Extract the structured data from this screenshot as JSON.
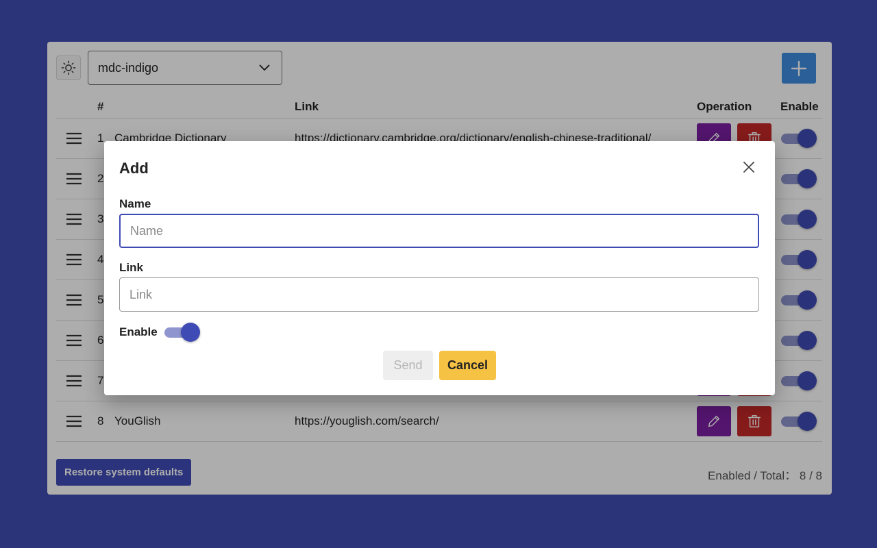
{
  "header": {
    "theme_icon": "sun-icon",
    "selected_theme": "mdc-indigo",
    "add_icon": "plus-icon"
  },
  "table": {
    "columns": {
      "num": "#",
      "link": "Link",
      "operation": "Operation",
      "enable": "Enable"
    },
    "rows": [
      {
        "num": "1",
        "name": "Cambridge Dictionary",
        "link": "https://dictionary.cambridge.org/dictionary/english-chinese-traditional/",
        "enabled": true
      },
      {
        "num": "2",
        "name": "",
        "link": "",
        "enabled": true
      },
      {
        "num": "3",
        "name": "",
        "link": "",
        "enabled": true
      },
      {
        "num": "4",
        "name": "",
        "link": "",
        "enabled": true
      },
      {
        "num": "5",
        "name": "",
        "link": "",
        "enabled": true
      },
      {
        "num": "6",
        "name": "",
        "link": "",
        "enabled": true
      },
      {
        "num": "7",
        "name": "",
        "link": "",
        "enabled": true
      },
      {
        "num": "8",
        "name": "YouGlish",
        "link": "https://youglish.com/search/",
        "enabled": true
      }
    ]
  },
  "footer": {
    "restore_label": "Restore system defaults",
    "counts": "Enabled / Total： 8 / 8"
  },
  "dialog": {
    "title": "Add",
    "name_label": "Name",
    "name_placeholder": "Name",
    "name_value": "",
    "link_label": "Link",
    "link_placeholder": "Link",
    "link_value": "",
    "enable_label": "Enable",
    "enabled": true,
    "send_label": "Send",
    "cancel_label": "Cancel"
  },
  "colors": {
    "background": "#2c3479",
    "primary": "#3f4bb4",
    "edit": "#7b1fa2",
    "delete": "#c62828",
    "add": "#3f8de0",
    "cancel": "#f6c244"
  }
}
